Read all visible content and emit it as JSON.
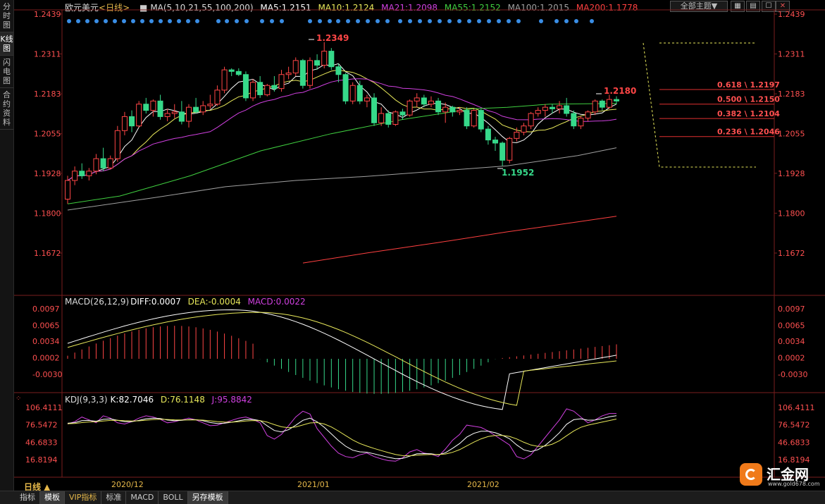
{
  "sidebar": {
    "tabs": [
      "分时图",
      "K线图",
      "闪电图",
      "合约资料"
    ],
    "active": 1
  },
  "header": {
    "symbol": "欧元美元",
    "period_tag": "<日线>",
    "ma_params": "MA(5,10,21,55,100,200)",
    "items": [
      {
        "label": "MA5:1.2151",
        "color": "#ffffff"
      },
      {
        "label": "MA10:1.2124",
        "color": "#e8e85a"
      },
      {
        "label": "MA21:1.2098",
        "color": "#d040e0"
      },
      {
        "label": "MA55:1.2152",
        "color": "#40d040"
      },
      {
        "label": "MA100:1.2015",
        "color": "#a0a0a0"
      },
      {
        "label": "MA200:1.1778",
        "color": "#ff4040"
      }
    ],
    "theme_button": "全部主题▼"
  },
  "window_buttons": [
    "▦",
    "▤",
    "☐",
    "✕"
  ],
  "colors": {
    "up": "#ff4646",
    "down": "#36d98a",
    "grid": "#7a1e1e",
    "axis_text": "#ff5050"
  },
  "price_axis": {
    "ticks": [
      "1.2439",
      "1.2311",
      "1.2183",
      "1.2055",
      "1.1928",
      "1.1800",
      "1.1672"
    ],
    "values": [
      1.2439,
      1.2311,
      1.2183,
      1.2055,
      1.1928,
      1.18,
      1.1672
    ]
  },
  "annotations": {
    "high": "1.2349",
    "low": "1.1952",
    "last_high": "1.2180"
  },
  "fibonacci": [
    {
      "label": "0.618 \\ 1.2197",
      "value": 1.2197
    },
    {
      "label": "0.500 \\ 1.2150",
      "value": 1.215
    },
    {
      "label": "0.382 \\ 1.2104",
      "value": 1.2104
    },
    {
      "label": "0.236 \\ 1.2046",
      "value": 1.2046
    }
  ],
  "macd": {
    "header": "MACD(26,12,9)",
    "diff": "DIFF:0.0007",
    "dea": "DEA:-0.0004",
    "macd": "MACD:0.0022",
    "ticks": [
      "0.0097",
      "0.0065",
      "0.0034",
      "0.0002",
      "-0.0030"
    ],
    "values": [
      0.0097,
      0.0065,
      0.0034,
      0.0002,
      -0.003
    ]
  },
  "kdj": {
    "header": "KDJ(9,3,3)",
    "k": "K:82.7046",
    "d": "D:76.1148",
    "j": "J:95.8842",
    "ticks": [
      "106.4111",
      "76.5472",
      "46.6833",
      "16.8194"
    ],
    "values": [
      106.4111,
      76.5472,
      46.6833,
      16.8194
    ]
  },
  "time_axis": [
    "2020/12",
    "2021/01",
    "2021/02"
  ],
  "period_label": "日线 ▲",
  "bottom_tabs": [
    "指标",
    "模板",
    "VIP指标",
    "标准",
    "MACD",
    "BOLL",
    "另存模板"
  ],
  "bottom_active": [
    1,
    6
  ],
  "logo": {
    "text": "汇金网",
    "url": "www.gold678.com"
  }
}
